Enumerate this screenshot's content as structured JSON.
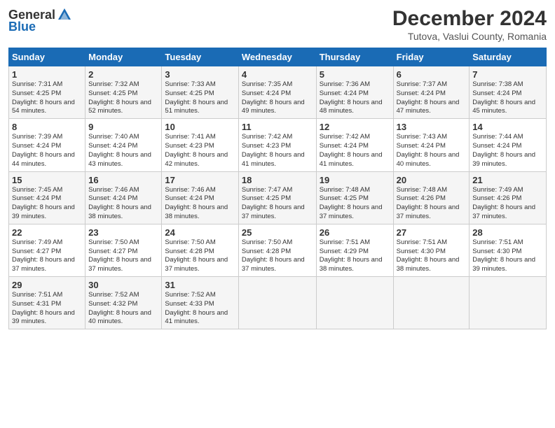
{
  "header": {
    "logo_general": "General",
    "logo_blue": "Blue",
    "month_title": "December 2024",
    "location": "Tutova, Vaslui County, Romania"
  },
  "days_of_week": [
    "Sunday",
    "Monday",
    "Tuesday",
    "Wednesday",
    "Thursday",
    "Friday",
    "Saturday"
  ],
  "weeks": [
    [
      {
        "day": "1",
        "sunrise": "7:31 AM",
        "sunset": "4:25 PM",
        "daylight": "8 hours and 54 minutes."
      },
      {
        "day": "2",
        "sunrise": "7:32 AM",
        "sunset": "4:25 PM",
        "daylight": "8 hours and 52 minutes."
      },
      {
        "day": "3",
        "sunrise": "7:33 AM",
        "sunset": "4:25 PM",
        "daylight": "8 hours and 51 minutes."
      },
      {
        "day": "4",
        "sunrise": "7:35 AM",
        "sunset": "4:24 PM",
        "daylight": "8 hours and 49 minutes."
      },
      {
        "day": "5",
        "sunrise": "7:36 AM",
        "sunset": "4:24 PM",
        "daylight": "8 hours and 48 minutes."
      },
      {
        "day": "6",
        "sunrise": "7:37 AM",
        "sunset": "4:24 PM",
        "daylight": "8 hours and 47 minutes."
      },
      {
        "day": "7",
        "sunrise": "7:38 AM",
        "sunset": "4:24 PM",
        "daylight": "8 hours and 45 minutes."
      }
    ],
    [
      {
        "day": "8",
        "sunrise": "7:39 AM",
        "sunset": "4:24 PM",
        "daylight": "8 hours and 44 minutes."
      },
      {
        "day": "9",
        "sunrise": "7:40 AM",
        "sunset": "4:24 PM",
        "daylight": "8 hours and 43 minutes."
      },
      {
        "day": "10",
        "sunrise": "7:41 AM",
        "sunset": "4:23 PM",
        "daylight": "8 hours and 42 minutes."
      },
      {
        "day": "11",
        "sunrise": "7:42 AM",
        "sunset": "4:23 PM",
        "daylight": "8 hours and 41 minutes."
      },
      {
        "day": "12",
        "sunrise": "7:42 AM",
        "sunset": "4:24 PM",
        "daylight": "8 hours and 41 minutes."
      },
      {
        "day": "13",
        "sunrise": "7:43 AM",
        "sunset": "4:24 PM",
        "daylight": "8 hours and 40 minutes."
      },
      {
        "day": "14",
        "sunrise": "7:44 AM",
        "sunset": "4:24 PM",
        "daylight": "8 hours and 39 minutes."
      }
    ],
    [
      {
        "day": "15",
        "sunrise": "7:45 AM",
        "sunset": "4:24 PM",
        "daylight": "8 hours and 39 minutes."
      },
      {
        "day": "16",
        "sunrise": "7:46 AM",
        "sunset": "4:24 PM",
        "daylight": "8 hours and 38 minutes."
      },
      {
        "day": "17",
        "sunrise": "7:46 AM",
        "sunset": "4:24 PM",
        "daylight": "8 hours and 38 minutes."
      },
      {
        "day": "18",
        "sunrise": "7:47 AM",
        "sunset": "4:25 PM",
        "daylight": "8 hours and 37 minutes."
      },
      {
        "day": "19",
        "sunrise": "7:48 AM",
        "sunset": "4:25 PM",
        "daylight": "8 hours and 37 minutes."
      },
      {
        "day": "20",
        "sunrise": "7:48 AM",
        "sunset": "4:26 PM",
        "daylight": "8 hours and 37 minutes."
      },
      {
        "day": "21",
        "sunrise": "7:49 AM",
        "sunset": "4:26 PM",
        "daylight": "8 hours and 37 minutes."
      }
    ],
    [
      {
        "day": "22",
        "sunrise": "7:49 AM",
        "sunset": "4:27 PM",
        "daylight": "8 hours and 37 minutes."
      },
      {
        "day": "23",
        "sunrise": "7:50 AM",
        "sunset": "4:27 PM",
        "daylight": "8 hours and 37 minutes."
      },
      {
        "day": "24",
        "sunrise": "7:50 AM",
        "sunset": "4:28 PM",
        "daylight": "8 hours and 37 minutes."
      },
      {
        "day": "25",
        "sunrise": "7:50 AM",
        "sunset": "4:28 PM",
        "daylight": "8 hours and 37 minutes."
      },
      {
        "day": "26",
        "sunrise": "7:51 AM",
        "sunset": "4:29 PM",
        "daylight": "8 hours and 38 minutes."
      },
      {
        "day": "27",
        "sunrise": "7:51 AM",
        "sunset": "4:30 PM",
        "daylight": "8 hours and 38 minutes."
      },
      {
        "day": "28",
        "sunrise": "7:51 AM",
        "sunset": "4:30 PM",
        "daylight": "8 hours and 39 minutes."
      }
    ],
    [
      {
        "day": "29",
        "sunrise": "7:51 AM",
        "sunset": "4:31 PM",
        "daylight": "8 hours and 39 minutes."
      },
      {
        "day": "30",
        "sunrise": "7:52 AM",
        "sunset": "4:32 PM",
        "daylight": "8 hours and 40 minutes."
      },
      {
        "day": "31",
        "sunrise": "7:52 AM",
        "sunset": "4:33 PM",
        "daylight": "8 hours and 41 minutes."
      },
      null,
      null,
      null,
      null
    ]
  ]
}
